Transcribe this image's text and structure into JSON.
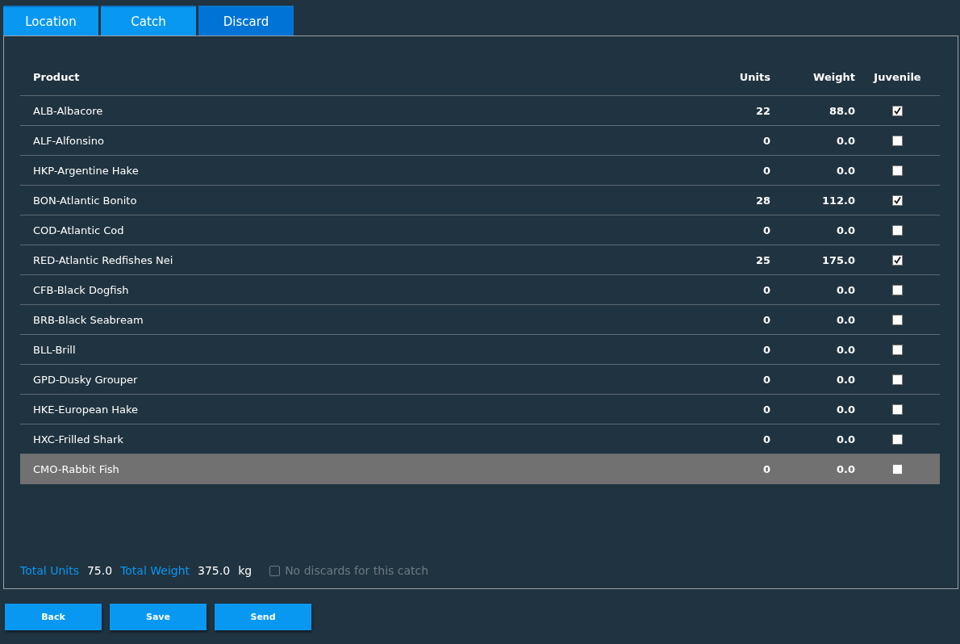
{
  "tabs": [
    {
      "label": "Location",
      "selected": false
    },
    {
      "label": "Catch",
      "selected": false
    },
    {
      "label": "Discard",
      "selected": true
    }
  ],
  "table": {
    "columns": [
      "Product",
      "Units",
      "Weight",
      "Juvenile"
    ],
    "rows": [
      {
        "product": "ALB-Albacore",
        "units": "22",
        "weight": "88.0",
        "juvenile": true,
        "selected": false
      },
      {
        "product": "ALF-Alfonsino",
        "units": "0",
        "weight": "0.0",
        "juvenile": false,
        "selected": false
      },
      {
        "product": "HKP-Argentine Hake",
        "units": "0",
        "weight": "0.0",
        "juvenile": false,
        "selected": false
      },
      {
        "product": "BON-Atlantic Bonito",
        "units": "28",
        "weight": "112.0",
        "juvenile": true,
        "selected": false
      },
      {
        "product": "COD-Atlantic Cod",
        "units": "0",
        "weight": "0.0",
        "juvenile": false,
        "selected": false
      },
      {
        "product": "RED-Atlantic Redfishes Nei",
        "units": "25",
        "weight": "175.0",
        "juvenile": true,
        "selected": false
      },
      {
        "product": "CFB-Black Dogfish",
        "units": "0",
        "weight": "0.0",
        "juvenile": false,
        "selected": false
      },
      {
        "product": "BRB-Black Seabream",
        "units": "0",
        "weight": "0.0",
        "juvenile": false,
        "selected": false
      },
      {
        "product": "BLL-Brill",
        "units": "0",
        "weight": "0.0",
        "juvenile": false,
        "selected": false
      },
      {
        "product": "GPD-Dusky Grouper",
        "units": "0",
        "weight": "0.0",
        "juvenile": false,
        "selected": false
      },
      {
        "product": "HKE-European Hake",
        "units": "0",
        "weight": "0.0",
        "juvenile": false,
        "selected": false
      },
      {
        "product": "HXC-Frilled Shark",
        "units": "0",
        "weight": "0.0",
        "juvenile": false,
        "selected": false
      },
      {
        "product": "CMO-Rabbit Fish",
        "units": "0",
        "weight": "0.0",
        "juvenile": false,
        "selected": true
      }
    ]
  },
  "totals": {
    "units_label": "Total Units",
    "units": "75.0",
    "weight_label": "Total Weight",
    "weight": "375.0",
    "weight_unit": "kg",
    "no_discards": {
      "label": "No discards for this catch",
      "checked": false,
      "disabled": true
    }
  },
  "buttons": [
    "Back",
    "Save",
    "Send"
  ]
}
